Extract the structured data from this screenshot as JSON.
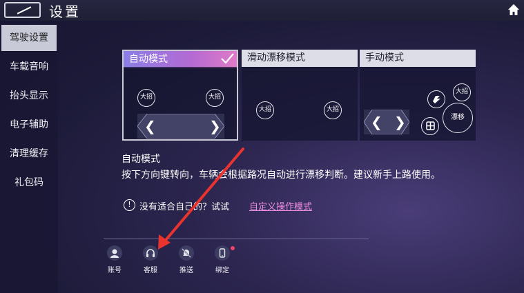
{
  "header": {
    "title": "设置",
    "back_icon": "back-slash-icon",
    "home_icon": "home-icon"
  },
  "sidebar": {
    "items": [
      {
        "label": "驾驶设置",
        "active": true
      },
      {
        "label": "车载音响",
        "active": false
      },
      {
        "label": "抬头显示",
        "active": false
      },
      {
        "label": "电子辅助",
        "active": false
      },
      {
        "label": "清理缓存",
        "active": false
      },
      {
        "label": "礼包码",
        "active": false
      }
    ]
  },
  "modes": [
    {
      "title": "自动模式",
      "selected": true,
      "skill_label": "大招"
    },
    {
      "title": "滑动漂移模式",
      "selected": false,
      "skill_label": "大招"
    },
    {
      "title": "手动模式",
      "selected": false,
      "skill_label": "大招",
      "drift_label": "漂移"
    }
  ],
  "description": {
    "title": "自动模式",
    "text": "按下方向键转向，车辆会根据路况自动进行漂移判断。建议新手上路使用。"
  },
  "hint": {
    "text": "没有适合自己的？试试",
    "link": "自定义操作模式",
    "icon": "info-icon"
  },
  "actions": [
    {
      "label": "账号",
      "icon": "account-icon"
    },
    {
      "label": "客服",
      "icon": "headset-icon"
    },
    {
      "label": "推送",
      "icon": "bell-muted-icon"
    },
    {
      "label": "绑定",
      "icon": "phone-icon",
      "badge": true
    }
  ],
  "colors": {
    "accent_gradient_start": "#8a7fe6",
    "accent_gradient_end": "#e07ac8",
    "link": "#ec8ee0",
    "annotation_arrow": "#e8332e",
    "badge": "#f0456a"
  }
}
